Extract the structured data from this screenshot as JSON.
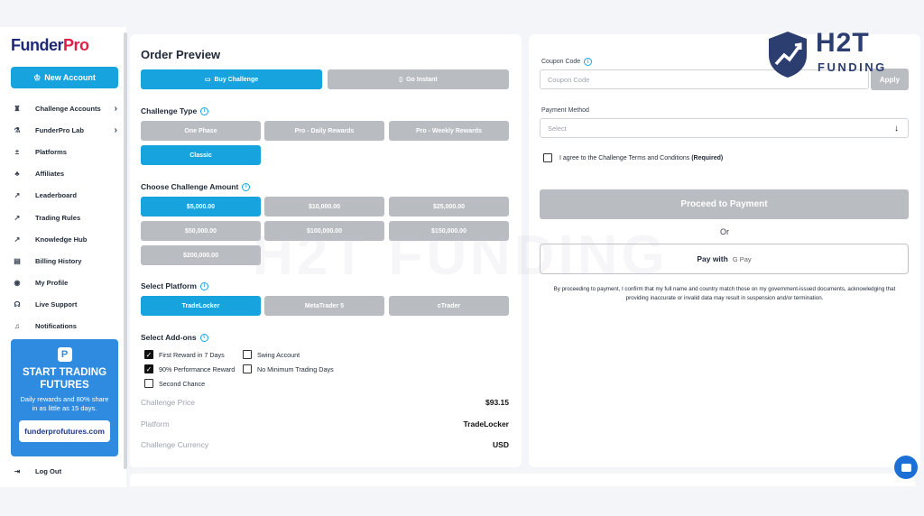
{
  "sidebar": {
    "logo_main": "Funder",
    "logo_accent": "Pro",
    "new_account": "New Account",
    "items": [
      {
        "label": "Challenge Accounts",
        "icon": "trophy-icon",
        "glyph": "♜",
        "chevron": true
      },
      {
        "label": "FunderPro Lab",
        "icon": "flask-icon",
        "glyph": "⚗",
        "chevron": true
      },
      {
        "label": "Platforms",
        "icon": "plus-minus-icon",
        "glyph": "±",
        "chevron": false
      },
      {
        "label": "Affiliates",
        "icon": "people-icon",
        "glyph": "♣",
        "chevron": false
      },
      {
        "label": "Leaderboard",
        "icon": "external-link-icon",
        "glyph": "↗",
        "chevron": false
      },
      {
        "label": "Trading Rules",
        "icon": "external-link-icon",
        "glyph": "↗",
        "chevron": false
      },
      {
        "label": "Knowledge Hub",
        "icon": "external-link-icon",
        "glyph": "↗",
        "chevron": false
      },
      {
        "label": "Billing History",
        "icon": "receipt-icon",
        "glyph": "▤",
        "chevron": false
      },
      {
        "label": "My Profile",
        "icon": "profile-icon",
        "glyph": "◉",
        "chevron": false
      },
      {
        "label": "Live Support",
        "icon": "headset-icon",
        "glyph": "☊",
        "chevron": false
      },
      {
        "label": "Notifications",
        "icon": "bell-icon",
        "glyph": "♫",
        "chevron": false
      }
    ],
    "promo": {
      "title": "START TRADING FUTURES",
      "subtitle": "Daily rewards and 80% share in as little as 15 days.",
      "link": "funderprofutures.com"
    },
    "logout": "Log Out"
  },
  "order": {
    "title": "Order Preview",
    "tabs": {
      "buy": "Buy Challenge",
      "instant": "Go Instant"
    },
    "challenge_type_label": "Challenge Type",
    "challenge_types": [
      "One Phase",
      "Pro - Daily Rewards",
      "Pro - Weekly Rewards",
      "Classic"
    ],
    "amount_label": "Choose Challenge Amount",
    "amounts": [
      "$5,000.00",
      "$10,000.00",
      "$25,000.00",
      "$50,000.00",
      "$100,000.00",
      "$150,000.00",
      "$200,000.00"
    ],
    "platform_label": "Select Platform",
    "platforms": [
      "TradeLocker",
      "MetaTrader 5",
      "cTrader"
    ],
    "addons_label": "Select Add-ons",
    "addons": {
      "first_reward": {
        "label": "First Reward in 7 Days",
        "checked": true
      },
      "swing": {
        "label": "Swing Account",
        "checked": false
      },
      "performance": {
        "label": "90% Performance Reward",
        "checked": true
      },
      "no_min": {
        "label": "No Minimum Trading Days",
        "checked": false
      },
      "second_chance": {
        "label": "Second Chance",
        "checked": false
      }
    },
    "summary": {
      "price_label": "Challenge Price",
      "price": "$93.15",
      "platform_label": "Platform",
      "platform": "TradeLocker",
      "currency_label": "Challenge Currency",
      "currency": "USD"
    }
  },
  "payment": {
    "coupon_label": "Coupon Code",
    "coupon_placeholder": "Coupon Code",
    "apply": "Apply",
    "method_label": "Payment Method",
    "method_placeholder": "Select",
    "terms_text": "I agree to the Challenge Terms and Conditions",
    "terms_required": "(Required)",
    "proceed": "Proceed to Payment",
    "or": "Or",
    "gpay_text": "Pay with",
    "gpay_brand": "G Pay",
    "disclaimer": "By proceeding to payment, I confirm that my full name and country match those on my government-issued documents, acknowledging that providing inaccurate or invalid data may result in suspension and/or termination."
  },
  "brand": {
    "top": "H2T",
    "bottom": "FUNDING",
    "watermark": "H2T FUNDING"
  },
  "colors": {
    "accent": "#16a3de",
    "disabled": "#b9bcc1",
    "brand_navy": "#1e2a78",
    "brand_red": "#e11d48"
  }
}
